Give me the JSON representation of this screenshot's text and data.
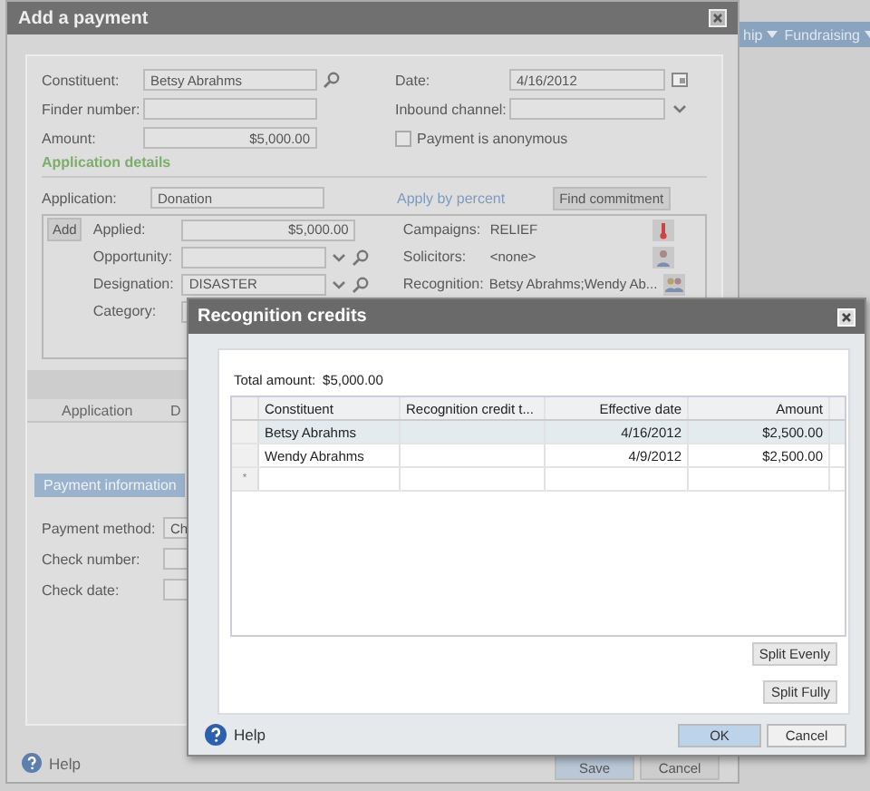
{
  "app_nav": [
    {
      "label": "hip"
    },
    {
      "label": "Fundraising"
    }
  ],
  "payment_dialog": {
    "title": "Add a payment",
    "left_fields": [
      {
        "label": "Constituent:",
        "value": "Betsy Abrahms",
        "kind": "search"
      },
      {
        "label": "Finder number:",
        "kind": "text"
      },
      {
        "label": "Amount:",
        "value": "$5,000.00",
        "kind": "amount"
      }
    ],
    "right_fields": [
      {
        "label": "Date:",
        "value": "4/16/2012",
        "kind": "date"
      },
      {
        "label": "Inbound channel:",
        "kind": "select"
      }
    ],
    "anonymous": {
      "label": "Payment is anonymous",
      "checked": false
    },
    "section_title": "Application details",
    "application": {
      "label": "Application:",
      "value": "Donation"
    },
    "apply_by_percent": "Apply by percent",
    "find_commitment": "Find commitment",
    "add_button": "Add",
    "application_fields": [
      {
        "label": "Applied:",
        "value": "$5,000.00",
        "kind": "amount"
      },
      {
        "label": "Opportunity:",
        "kind": "select-search"
      },
      {
        "label": "Designation:",
        "value": "DISASTER",
        "kind": "select-search"
      },
      {
        "label": "Category:",
        "kind": "text"
      }
    ],
    "application_info": [
      {
        "label": "Campaigns:",
        "value": "RELIEF",
        "kind": "campaign"
      },
      {
        "label": "Solicitors:",
        "value": "<none>",
        "kind": "person"
      },
      {
        "label": "Recognition:",
        "value": "Betsy Abrahms;Wendy Ab...",
        "kind": "people"
      }
    ],
    "grid_columns": [
      "Application",
      "D"
    ],
    "tabs": [
      {
        "label": "Payment information",
        "selected": true
      }
    ],
    "payment_fields": [
      {
        "label": "Payment method:",
        "value": "Ch"
      },
      {
        "label": "Check number:"
      },
      {
        "label": "Check date:"
      }
    ],
    "help": "Help",
    "buttons": [
      "Save",
      "Cancel"
    ]
  },
  "recognition_dialog": {
    "title": "Recognition credits",
    "total_label": "Total amount:",
    "total_value": "$5,000.00",
    "columns": [
      "Constituent",
      "Recognition credit t...",
      "Effective date",
      "Amount"
    ],
    "rows": [
      {
        "constituent": "Betsy Abrahms",
        "effective_date": "4/16/2012",
        "amount": "$2,500.00",
        "selected": true
      },
      {
        "constituent": "Wendy Abrahms",
        "effective_date": "4/9/2012",
        "amount": "$2,500.00",
        "selected": false
      }
    ],
    "new_row_marker": "*",
    "split_evenly": "Split Evenly",
    "split_fully": "Split Fully",
    "help": "Help",
    "ok": "OK",
    "cancel": "Cancel"
  }
}
